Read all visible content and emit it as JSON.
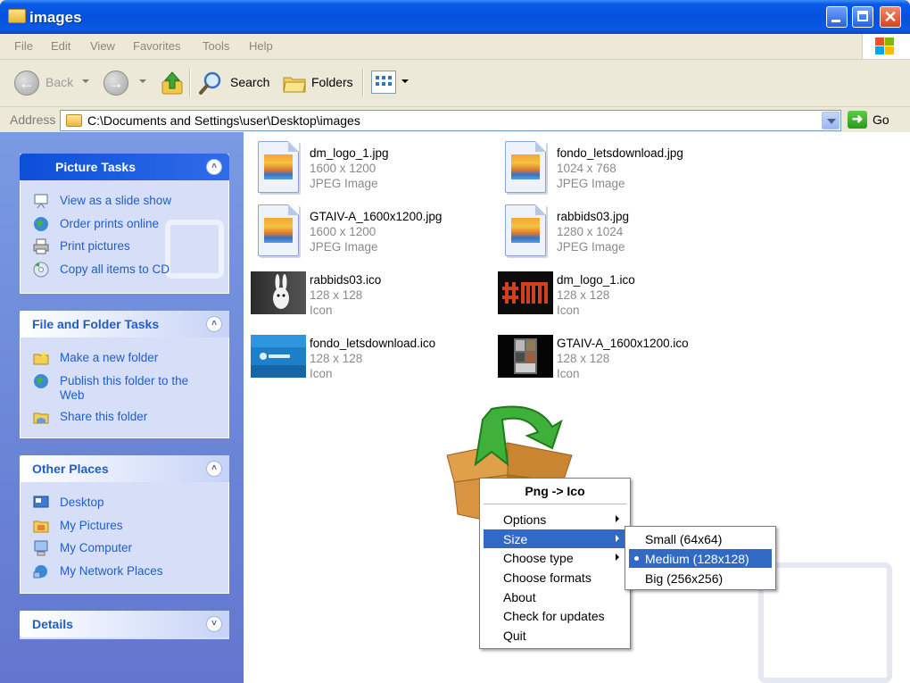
{
  "window": {
    "title": "images"
  },
  "menubar": [
    "File",
    "Edit",
    "View",
    "Favorites",
    "Tools",
    "Help"
  ],
  "toolbar": {
    "back": "Back",
    "search": "Search",
    "folders": "Folders"
  },
  "address": {
    "label": "Address",
    "path": "C:\\Documents and Settings\\user\\Desktop\\images",
    "go": "Go"
  },
  "sidebar": {
    "picture_tasks": {
      "title": "Picture Tasks",
      "items": [
        "View as a slide show",
        "Order prints online",
        "Print pictures",
        "Copy all items to CD"
      ]
    },
    "file_folder_tasks": {
      "title": "File and Folder Tasks",
      "items": [
        "Make a new folder",
        "Publish this folder to the Web",
        "Share this folder"
      ]
    },
    "other_places": {
      "title": "Other Places",
      "items": [
        "Desktop",
        "My Pictures",
        "My Computer",
        "My Network Places"
      ]
    },
    "details": {
      "title": "Details"
    }
  },
  "files": [
    {
      "name": "dm_logo_1.jpg",
      "dims": "1600 x 1200",
      "type": "JPEG Image",
      "icon": "jpeg-file-icon"
    },
    {
      "name": "fondo_letsdownload.jpg",
      "dims": "1024 x 768",
      "type": "JPEG Image",
      "icon": "jpeg-file-icon"
    },
    {
      "name": "GTAIV-A_1600x1200.jpg",
      "dims": "1600 x 1200",
      "type": "JPEG Image",
      "icon": "jpeg-file-icon"
    },
    {
      "name": "rabbids03.jpg",
      "dims": "1280 x 1024",
      "type": "JPEG Image",
      "icon": "jpeg-file-icon"
    },
    {
      "name": "rabbids03.ico",
      "dims": "128 x 128",
      "type": "Icon",
      "icon": "rabbid-thumbnail"
    },
    {
      "name": "dm_logo_1.ico",
      "dims": "128 x 128",
      "type": "Icon",
      "icon": "dm-logo-thumbnail"
    },
    {
      "name": "fondo_letsdownload.ico",
      "dims": "128 x 128",
      "type": "Icon",
      "icon": "letsdownload-thumbnail"
    },
    {
      "name": "GTAIV-A_1600x1200.ico",
      "dims": "128 x 128",
      "type": "Icon",
      "icon": "gtaiv-thumbnail"
    }
  ],
  "context_menu": {
    "title": "Png -> Ico",
    "items": [
      "Options",
      "Size",
      "Choose type",
      "Choose formats",
      "About",
      "Check for updates",
      "Quit"
    ],
    "selected": "Size"
  },
  "submenu": {
    "items": [
      "Small (64x64)",
      "Medium (128x128)",
      "Big (256x256)"
    ],
    "selected": "Medium (128x128)"
  },
  "colors": {
    "title_blue": "#0551de",
    "selection": "#316ac5",
    "task_link": "#215dc6",
    "sidebar": "#6a84d6"
  }
}
